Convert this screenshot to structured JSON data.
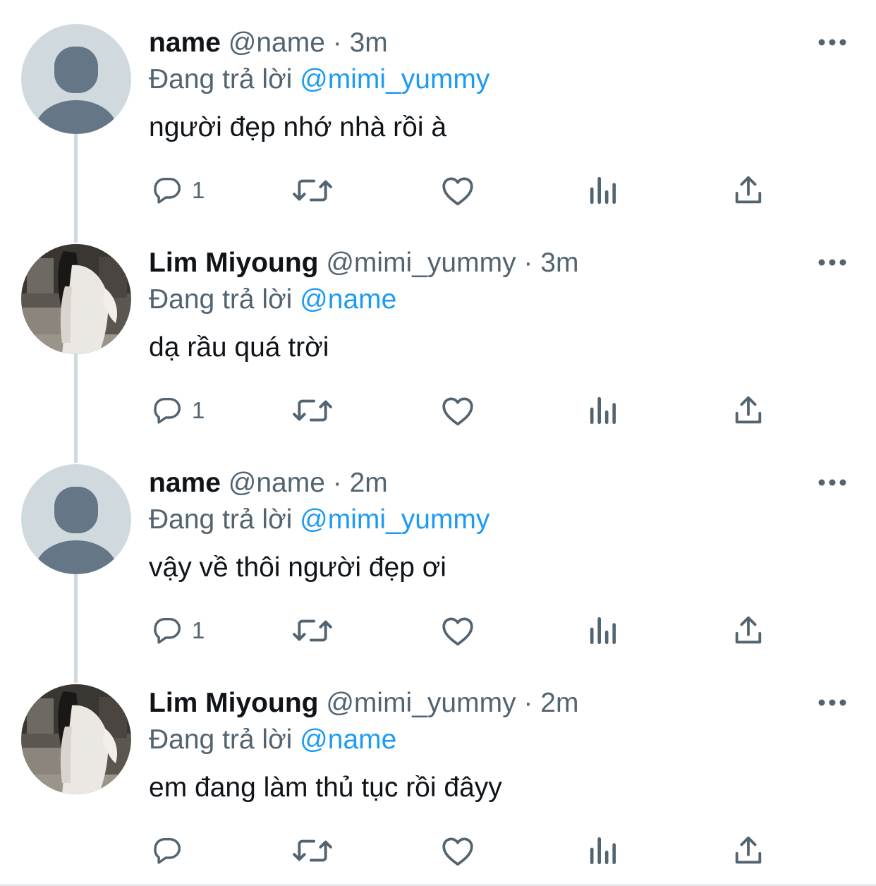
{
  "thread": [
    {
      "avatar": "default-avatar",
      "display_name": "name",
      "handle": "@name",
      "separator": "·",
      "time": "3m",
      "reply_prefix": "Đang trả lời",
      "reply_to": "@mimi_yummy",
      "text": "người đẹp nhớ nhà rồi à",
      "reply_count": "1"
    },
    {
      "avatar": "photo-avatar",
      "display_name": "Lim Miyoung",
      "handle": "@mimi_yummy",
      "separator": "·",
      "time": "3m",
      "reply_prefix": "Đang trả lời",
      "reply_to": "@name",
      "text": "dạ rầu quá trời",
      "reply_count": "1"
    },
    {
      "avatar": "default-avatar",
      "display_name": "name",
      "handle": "@name",
      "separator": "·",
      "time": "2m",
      "reply_prefix": "Đang trả lời",
      "reply_to": "@mimi_yummy",
      "text": "vậy về thôi người đẹp ơi",
      "reply_count": "1"
    },
    {
      "avatar": "photo-avatar",
      "display_name": "Lim Miyoung",
      "handle": "@mimi_yummy",
      "separator": "·",
      "time": "2m",
      "reply_prefix": "Đang trả lời",
      "reply_to": "@name",
      "text": "em đang làm thủ tục rồi đâyy",
      "reply_count": ""
    }
  ],
  "icons": {
    "more": "more-horizontal-icon",
    "reply": "reply-bubble-icon",
    "retweet": "retweet-icon",
    "like": "heart-icon",
    "views": "views-bar-chart-icon",
    "share": "share-upload-icon"
  },
  "colors": {
    "text": "#0f1419",
    "secondary": "#536471",
    "mention": "#1d9bf0",
    "thread_line": "#cfd9de",
    "default_avatar_bg": "#cfd9de",
    "default_avatar_fg": "#657786"
  }
}
